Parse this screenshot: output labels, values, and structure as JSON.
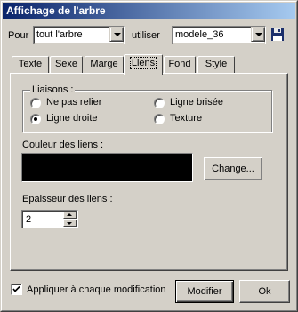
{
  "window": {
    "title": "Affichage de l'arbre"
  },
  "top": {
    "pour_label": "Pour",
    "pour_value": "tout l'arbre",
    "utiliser_label": "utiliser",
    "utiliser_value": "modele_36"
  },
  "tabs": [
    {
      "label": "Texte",
      "active": false
    },
    {
      "label": "Sexe",
      "active": false
    },
    {
      "label": "Marge",
      "active": false
    },
    {
      "label": "Liens",
      "active": true
    },
    {
      "label": "Fond",
      "active": false
    },
    {
      "label": "Style",
      "active": false
    }
  ],
  "liaisons": {
    "legend": "Liaisons :",
    "options": [
      {
        "label": "Ne pas relier",
        "selected": false
      },
      {
        "label": "Ligne brisée",
        "selected": false
      },
      {
        "label": "Ligne droite",
        "selected": true
      },
      {
        "label": "Texture",
        "selected": false
      }
    ]
  },
  "couleur": {
    "label": "Couleur des liens :",
    "value_color": "#000000",
    "change_button": "Change..."
  },
  "epaisseur": {
    "label": "Epaisseur des liens :",
    "value": "2"
  },
  "footer": {
    "apply_checkbox_label": "Appliquer à chaque modification",
    "apply_checked": true,
    "modifier_button": "Modifier",
    "ok_button": "Ok"
  },
  "colors": {
    "title_gradient_start": "#0a246a",
    "title_gradient_end": "#a6caf0",
    "face": "#d4d0c8"
  }
}
